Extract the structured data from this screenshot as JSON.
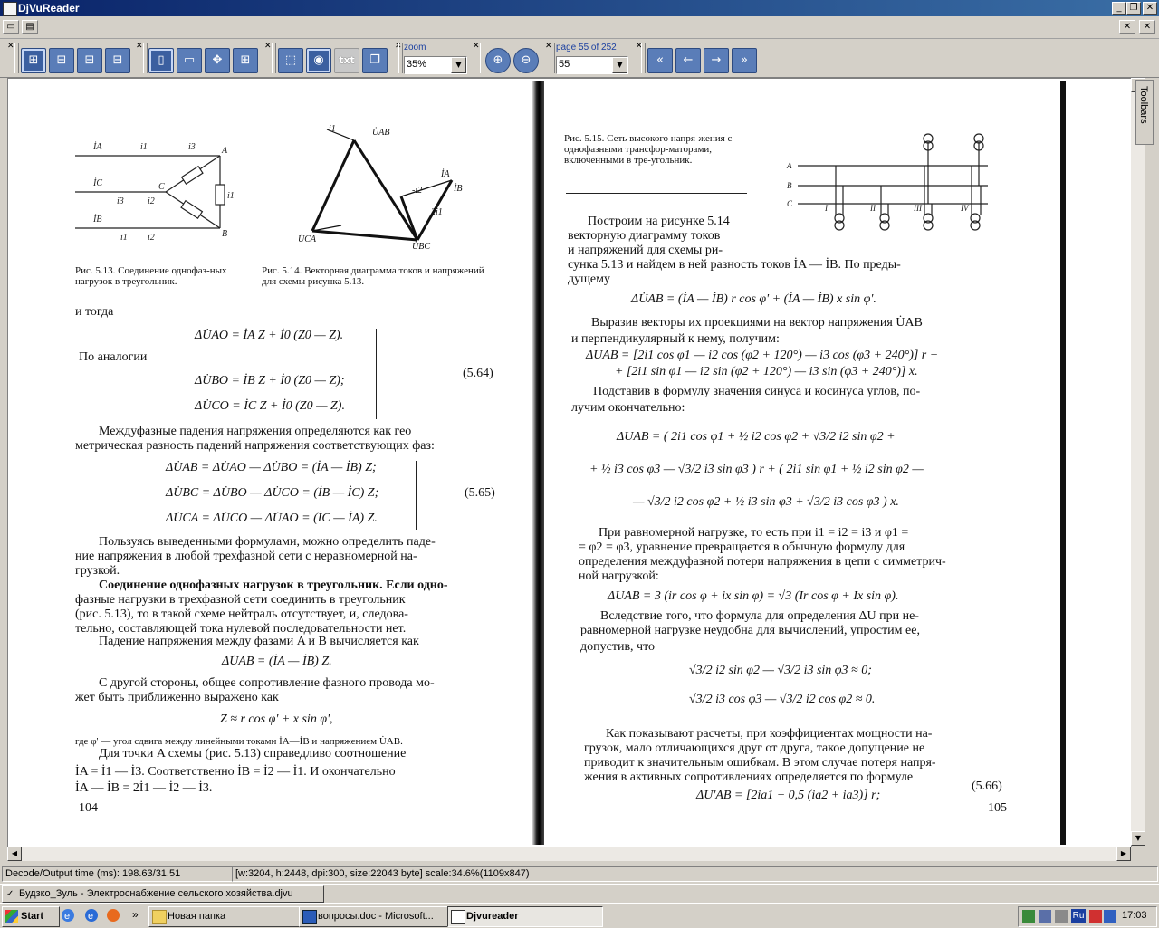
{
  "window": {
    "title": "DjVuReader"
  },
  "toolbar": {
    "zoom_label": "zoom",
    "zoom_value": "35%",
    "page_label": "page 55 of 252",
    "page_value": "55",
    "txt_button": "txt"
  },
  "side_panel": {
    "label": "Toolbars"
  },
  "left_page": {
    "caption_513": "Рис. 5.13. Соединение однофаз-ных нагрузок в треугольник.",
    "caption_514": "Рис. 5.14. Векторная диаграмма токов и напряжений для схемы рисунка 5.13.",
    "lines": [
      "и тогда",
      "ΔU̇AO = İA Z + İ0 (Z0 — Z).",
      "По аналогии",
      "ΔU̇BO = İB Z + İ0 (Z0 — Z);",
      "ΔU̇CO = İC Z + İ0 (Z0 — Z).",
      "(5.64)",
      "Междуфазные падения напряжения определяются как гео",
      "метрическая разность падений напряжения соответствующих фаз:",
      "ΔU̇AB = ΔU̇AO — ΔU̇BO = (İA — İB) Z;",
      "ΔU̇BC = ΔU̇BO — ΔU̇CO = (İB — İC) Z;",
      "ΔU̇CA = ΔU̇CO — ΔU̇AO = (İC — İA) Z.",
      "(5.65)",
      "Пользуясь выведенными формулами, можно определить паде-",
      "ние напряжения в любой трехфазной сети с неравномерной на-",
      "грузкой.",
      "Соединение однофазных нагрузок в треугольник. Если одно-",
      "фазные нагрузки в трехфазной сети соединить в треугольник",
      "(рис. 5.13), то в такой схеме нейтраль отсутствует, и, следова-",
      "тельно, составляющей тока нулевой последовательности нет.",
      "Падение напряжения между фазами A и B вычисляется как",
      "ΔU̇AB = (İA — İB) Z.",
      "С другой стороны, общее сопротивление фазного провода мо-",
      "жет быть приближенно выражено как",
      "Z ≈ r cos φ' + x sin φ',",
      "где φ' — угол сдвига между линейными токами İA—İB и напряжением U̇AB.",
      "Для точки A схемы (рис. 5.13) справедливо соотношение",
      "İA = İ1 — İ3. Соответственно İB = İ2 — İ1. И окончательно",
      "İA — İB = 2İ1 — İ2 — İ3."
    ],
    "page_number": "104"
  },
  "right_page": {
    "caption_515": "Рис. 5.15. Сеть высокого напря-жения с однофазными трансфор-маторами, включенными в тре-угольник.",
    "lines": [
      "Построим на рисунке 5.14",
      "векторную диаграмму токов",
      "и напряжений для схемы ри-",
      "сунка 5.13 и найдем в ней разность токов İA — İB. По преды-",
      "дущему",
      "ΔU̇AB = (İA — İB) r cos φ' + (İA — İB) x sin φ'.",
      "Выразив векторы их проекциями на вектор напряжения U̇AB",
      "и перпендикулярный к нему, получим:",
      "ΔUAB = [2i1 cos φ1 — i2 cos (φ2 + 120°) — i3 cos (φ3 + 240°)] r +",
      "+ [2i1 sin φ1 — i2 sin (φ2 + 120°) — i3 sin (φ3 + 240°)] x.",
      "Подставив в формулу значения синуса и косинуса углов, по-",
      "лучим окончательно:",
      "ΔUAB = ( 2i1 cos φ1 + ½ i2 cos φ2 + √3/2 i2 sin φ2 +",
      "+ ½ i3 cos φ3 — √3/2 i3 sin φ3 ) r + ( 2i1 sin φ1 + ½ i2 sin φ2 —",
      "— √3/2 i2 cos φ2 + ½ i3 sin φ3 + √3/2 i3 cos φ3 ) x.",
      "При равномерной нагрузке, то есть при i1 = i2 = i3 и φ1 =",
      "= φ2 = φ3, уравнение превращается в обычную формулу для",
      "определения междуфазной потери напряжения в цепи с симметрич-",
      "ной нагрузкой:",
      "ΔUAB = 3 (ir cos φ + ix sin φ) = √3 (Ir cos φ + Ix sin φ).",
      "Вследствие того, что формула для определения ΔU при не-",
      "равномерной нагрузке неудобна для вычислений, упростим ее,",
      "допустив, что",
      "√3/2 i2 sin φ2 — √3/2 i3 sin φ3 ≈ 0;",
      "√3/2 i3 cos φ3 — √3/2 i2 cos φ2 ≈ 0.",
      "Как показывают расчеты, при коэффициентах мощности на-",
      "грузок, мало отличающихся друг от друга, такое допущение не",
      "приводит к значительным ошибкам. В этом случае потеря напря-",
      "жения в активных сопротивлениях определяется по формуле",
      "(5.66)",
      "ΔU'AB = [2ia1 + 0,5 (ia2 + ia3)] r;"
    ],
    "page_number": "105"
  },
  "status": {
    "decode": "Decode/Output time (ms): 198.63/31.51",
    "info": "[w:3204, h:2448, dpi:300, size:22043 byte] scale:34.6%(1109x847)"
  },
  "doc_tab": {
    "filename": "Будзко_Зуль - Электроснабжение сельского хозяйства.djvu"
  },
  "taskbar": {
    "start": "Start",
    "items": [
      "Новая папка",
      "вопросы.doc - Microsoft...",
      "Djvureader"
    ],
    "more": "»",
    "lang": "Ru",
    "clock": "17:03"
  }
}
